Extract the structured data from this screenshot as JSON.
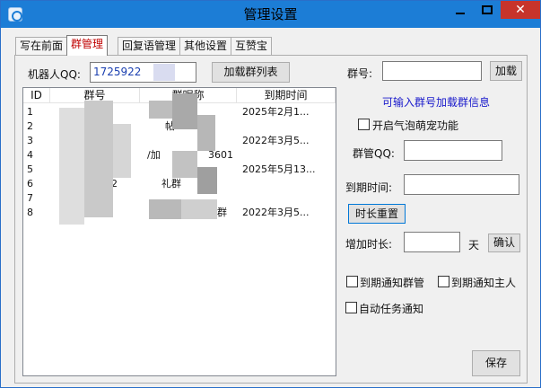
{
  "window": {
    "title": "管理设置",
    "close_glyph": "✕"
  },
  "tabs": [
    {
      "label": "写在前面",
      "active": false
    },
    {
      "label": "群管理",
      "active": true
    },
    {
      "label": "回复语管理",
      "active": false
    },
    {
      "label": "其他设置",
      "active": false
    },
    {
      "label": "互赞宝",
      "active": false
    }
  ],
  "robot": {
    "label": "机器人QQ:",
    "value": "1725922"
  },
  "load_list_button": "加载群列表",
  "table": {
    "headers": [
      "ID",
      "群号",
      "群昵称",
      "到期时间"
    ],
    "rows": [
      {
        "id": "1",
        "group": "",
        "nick": "",
        "expire": "2025年2月1..."
      },
      {
        "id": "2",
        "group": "",
        "nick": "帖",
        "expire": ""
      },
      {
        "id": "3",
        "group": "",
        "nick": "",
        "expire": "2022年3月5..."
      },
      {
        "id": "4",
        "group": "",
        "nick": "/加",
        "expire": ""
      },
      {
        "id": "5",
        "group": "",
        "nick": "",
        "expire": "2025年5月13..."
      },
      {
        "id": "6",
        "group": "2",
        "nick": "礼群",
        "expire": ""
      },
      {
        "id": "7",
        "group": "",
        "nick": "",
        "expire": ""
      },
      {
        "id": "8",
        "group": "",
        "nick": "群",
        "expire": "2022年3月5..."
      }
    ],
    "extra": {
      "row4_tail": "3601"
    }
  },
  "right": {
    "group_label": "群号:",
    "load_button": "加载",
    "hint": "可输入群号加载群信息",
    "bubble_checkbox": "开启气泡萌宠功能",
    "admin_label": "群管QQ:",
    "expire_label": "到期时间:",
    "reset_button": "时长重置",
    "add_label": "增加时长:",
    "day_unit": "天",
    "confirm_button": "确认",
    "notify_admin": "到期通知群管",
    "notify_owner": "到期通知主人",
    "auto_notify": "自动任务通知",
    "save_button": "保存"
  },
  "colors": {
    "titlebar": "#1c7dd6",
    "close": "#c7342b",
    "hint_blue": "#1a1acc",
    "active_tab": "#c00000"
  }
}
